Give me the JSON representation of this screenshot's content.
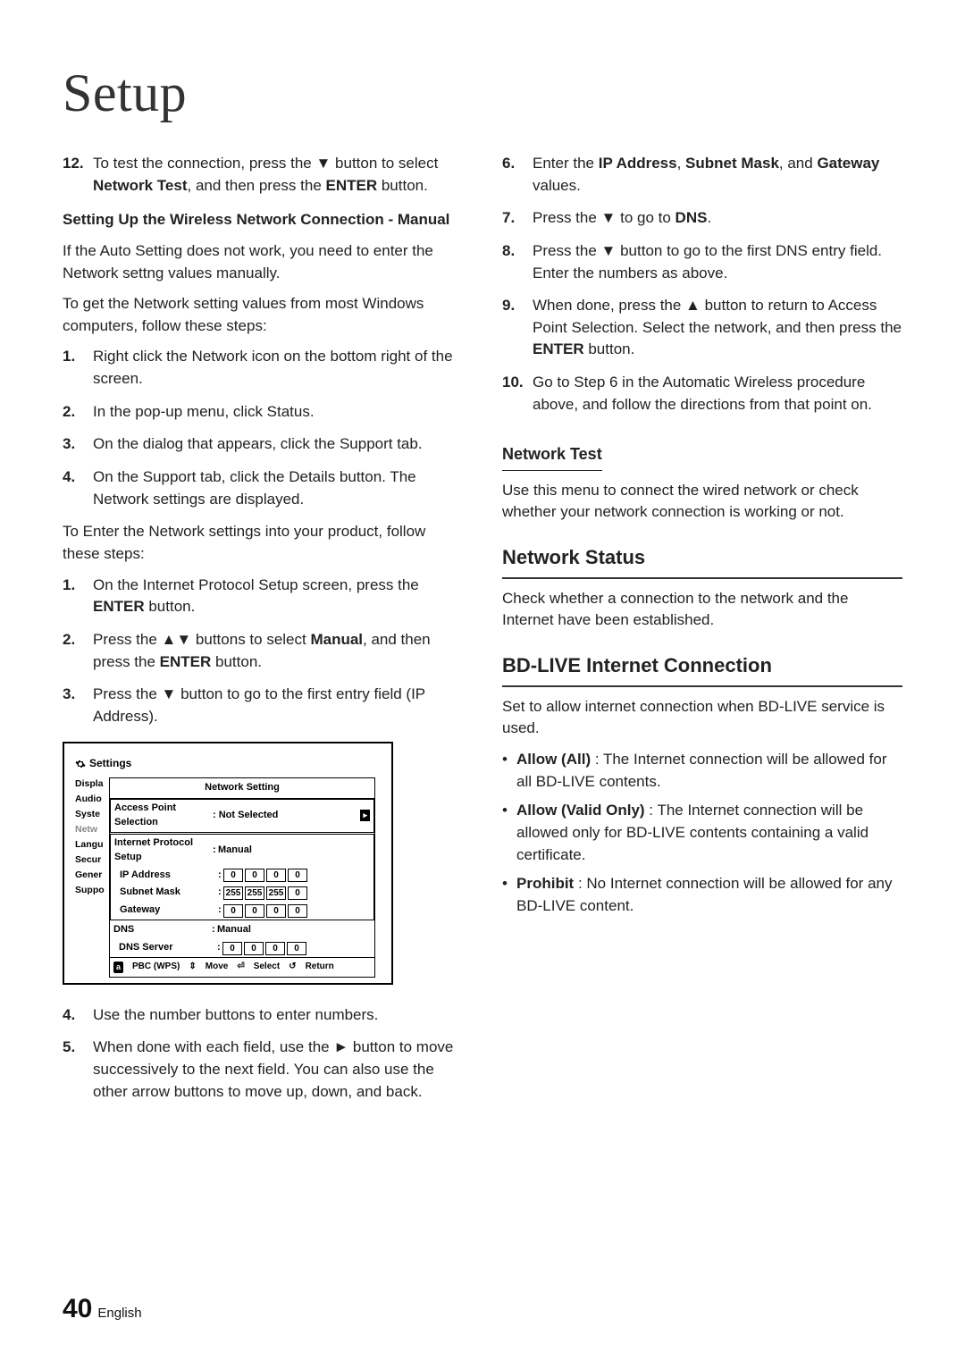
{
  "page": {
    "title": "Setup",
    "number": "40",
    "language": "English"
  },
  "glyph": {
    "down": "▼",
    "up": "▲",
    "right": "►",
    "updown": "▲▼"
  },
  "left": {
    "step12_pre": "To test the connection, press the ",
    "step12_mid1": " button to select ",
    "step12_b1": "Network Test",
    "step12_mid2": ", and then press the ",
    "step12_b2": "ENTER",
    "step12_post": " button.",
    "h_manual": "Setting Up the Wireless Network Connection - Manual",
    "p1": "If the Auto Setting does not work, you need to enter the Network settng values manually.",
    "p2": "To get the Network setting values from most Windows computers, follow these steps:",
    "winSteps": [
      "Right click the Network icon on the bottom right of the screen.",
      "In the pop-up menu, click Status.",
      "On the dialog that appears, click the Support tab.",
      "On the Support tab, click the Details button. The Network settings are displayed."
    ],
    "p3": "To Enter the Network settings into your product, follow these steps:",
    "prodSteps": {
      "s1_a": "On the Internet Protocol Setup screen, press the ",
      "s1_b": "ENTER",
      "s1_c": " button.",
      "s2_a": "Press the ",
      "s2_b": " buttons to select ",
      "s2_c": "Manual",
      "s2_d": ", and then press the ",
      "s2_e": "ENTER",
      "s2_f": " button.",
      "s3_a": "Press the ",
      "s3_b": " button to go to the first entry field (IP Address)."
    },
    "postSteps": {
      "s4": "Use the number buttons to enter numbers.",
      "s5_a": "When done with each field, use the ",
      "s5_b": " button to move successively to the next field. You can also use the other arrow buttons to move up, down, and back."
    }
  },
  "diagram": {
    "settings_label": "Settings",
    "side": [
      "Displa",
      "Audio",
      "Syste",
      "Netw",
      "Langu",
      "Secur",
      "Gener",
      "Suppo"
    ],
    "title": "Network Setting",
    "ap_label": "Access Point Selection",
    "ap_value": "Not Selected",
    "ipsetup_label": "Internet Protocol Setup",
    "ipsetup_value": "Manual",
    "rows": {
      "ip": {
        "label": "IP Address",
        "v": [
          "0",
          "0",
          "0",
          "0"
        ]
      },
      "mask": {
        "label": "Subnet Mask",
        "v": [
          "255",
          "255",
          "255",
          "0"
        ]
      },
      "gw": {
        "label": "Gateway",
        "v": [
          "0",
          "0",
          "0",
          "0"
        ]
      },
      "dns": {
        "label": "DNS",
        "value": "Manual"
      },
      "dnssrv": {
        "label": "DNS Server",
        "v": [
          "0",
          "0",
          "0",
          "0"
        ]
      }
    },
    "footer": {
      "aLabel": "a",
      "pbc": "PBC (WPS)",
      "moveIcon": "⇕",
      "move": "Move",
      "selIcon": "⏎",
      "select": "Select",
      "retIcon": "↺",
      "ret": "Return"
    }
  },
  "right": {
    "s6_a": "Enter the ",
    "s6_b1": "IP Address",
    "s6_m1": ", ",
    "s6_b2": "Subnet Mask",
    "s6_m2": ", and ",
    "s6_b3": "Gateway",
    "s6_c": " values.",
    "s7_a": "Press the ",
    "s7_b": " to go to ",
    "s7_c": "DNS",
    "s7_d": ".",
    "s8_a": "Press the ",
    "s8_b": " button to go to the first DNS entry field. Enter the numbers as above.",
    "s9_a": "When done, press the ",
    "s9_b": " button to return to Access Point Selection. Select the network, and then press the ",
    "s9_c": "ENTER",
    "s9_d": " button.",
    "s10": "Go to Step 6 in the Automatic Wireless procedure above, and follow the directions from that point on.",
    "networkTestH": "Network Test",
    "networkTestP": "Use this menu to connect the wired network or check whether your network connection is working or not.",
    "networkStatusH": "Network Status",
    "networkStatusP": "Check whether a connection to the network and the Internet have been established.",
    "bdH": "BD-LIVE Internet Connection",
    "bdP": "Set to allow internet connection when BD-LIVE service is used.",
    "bd_items": {
      "a_b": "Allow (All)",
      "a_t": " : The Internet connection will be allowed for all BD-LIVE contents.",
      "b_b": "Allow (Valid Only)",
      "b_t": " : The Internet connection will be allowed only for BD-LIVE contents containing a valid certificate.",
      "c_b": "Prohibit",
      "c_t": " : No Internet connection will be allowed for any BD-LIVE content."
    }
  }
}
